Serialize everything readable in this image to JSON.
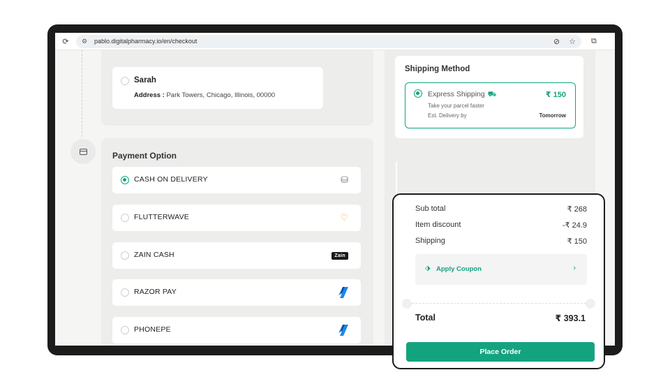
{
  "browser": {
    "url": "pablo.digitalpharmacy.io/en/checkout",
    "icons": [
      "reload-icon",
      "site-settings-icon",
      "no-tracking-icon",
      "star-icon",
      "extensions-icon"
    ]
  },
  "address": {
    "name": "Sarah",
    "address_label": "Address :",
    "address_value": "Park Towers, Chicago, Illinois, 00000"
  },
  "payment": {
    "title": "Payment Option",
    "options": [
      {
        "label": "CASH ON DELIVERY",
        "selected": true,
        "icon": "cash-icon"
      },
      {
        "label": "FLUTTERWAVE",
        "selected": false,
        "icon": "flutterwave-logo-icon"
      },
      {
        "label": "ZAIN CASH",
        "selected": false,
        "icon": "zain-cash-logo-icon",
        "logo_text": "Zain"
      },
      {
        "label": "RAZOR PAY",
        "selected": false,
        "icon": "razorpay-logo-icon"
      },
      {
        "label": "PHONEPE",
        "selected": false,
        "icon": "phonepe-logo-icon"
      }
    ]
  },
  "shipping": {
    "title": "Shipping Method",
    "option": {
      "name": "Express Shipping",
      "price": "₹ 150",
      "description": "Take your parcel faster",
      "est_label": "Est. Delivery by",
      "est_value": "Tomorrow",
      "selected": true
    }
  },
  "summary": {
    "subtotal_label": "Sub total",
    "subtotal_value": "₹ 268",
    "discount_label": "Item discount",
    "discount_value": "-₹ 24.9",
    "shipping_label": "Shipping",
    "shipping_value": "₹ 150",
    "coupon_label": "Apply Coupon",
    "total_label": "Total",
    "total_value": "₹ 393.1",
    "place_order": "Place Order"
  },
  "colors": {
    "accent": "#14a37f",
    "frame": "#1c1c1c"
  }
}
